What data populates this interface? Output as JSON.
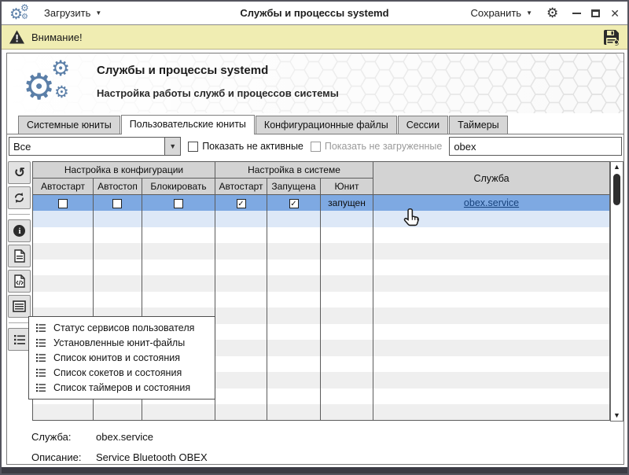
{
  "titlebar": {
    "load_button": "Загрузить",
    "title": "Службы и процессы systemd",
    "save_button": "Сохранить"
  },
  "warning_bar": {
    "text": "Внимание!"
  },
  "header": {
    "title": "Службы и процессы systemd",
    "subtitle": "Настройка работы служб и процессов системы"
  },
  "tabs": [
    {
      "label": "Системные юниты",
      "active": false
    },
    {
      "label": "Пользовательские юниты",
      "active": true
    },
    {
      "label": "Конфигурационные файлы",
      "active": false
    },
    {
      "label": "Сессии",
      "active": false
    },
    {
      "label": "Таймеры",
      "active": false
    }
  ],
  "filters": {
    "scope_dropdown_value": "Все",
    "show_inactive_label": "Показать не активные",
    "show_inactive_checked": false,
    "show_unloaded_label": "Показать не загруженные",
    "show_unloaded_checked": false,
    "show_unloaded_enabled": false,
    "search_value": "obex"
  },
  "table": {
    "group_headers": [
      "Настройка в конфигурации",
      "Настройка в системе"
    ],
    "service_header": "Служба",
    "sub_headers": [
      "Автостарт",
      "Автостоп",
      "Блокировать",
      "Автостарт",
      "Запущена",
      "Юнит"
    ],
    "rows": [
      {
        "autostart_config": false,
        "autostop_config": false,
        "block_config": false,
        "autostart_system": true,
        "running_system": true,
        "unit_state": "запущен",
        "service": "obex.service",
        "selected": true
      }
    ],
    "empty_rows": 13
  },
  "sidebar": {
    "buttons": [
      "history-icon",
      "refresh-icon",
      "info-icon",
      "document-icon",
      "code-document-icon",
      "list-icon",
      "bullet-list-icon"
    ]
  },
  "context_menu": {
    "items": [
      "Статус сервисов пользователя",
      "Установленные юнит-файлы",
      "Список юнитов и состояния",
      "Список сокетов и состояния",
      "Список таймеров и состояния"
    ]
  },
  "details": {
    "service_label": "Служба:",
    "service_value": "obex.service",
    "description_label": "Описание:",
    "description_value": "Service Bluetooth OBEX"
  },
  "icons": {
    "gear": "⚙",
    "caret_down": "▼",
    "history": "↺",
    "info": "i",
    "up_arrow": "▲",
    "down_arrow": "▼",
    "close": "✕"
  },
  "colors": {
    "selection_blue": "#7ea9e2",
    "hover_blue": "#dde8f7",
    "warning_yellow": "#f0edb2",
    "link_blue": "#17427c",
    "accent_steel_blue": "#5b7fa8"
  }
}
